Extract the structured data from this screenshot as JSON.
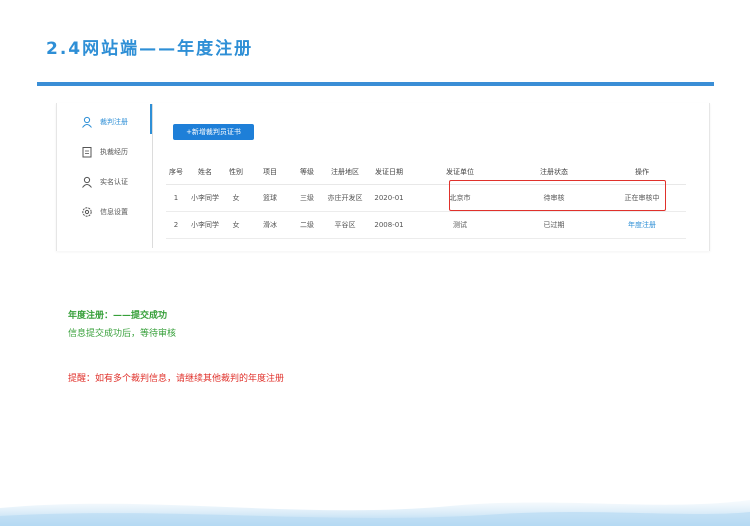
{
  "slide": {
    "title": "2.4网站端——年度注册"
  },
  "sidebar": {
    "items": [
      {
        "label": "裁判注册",
        "icon": "user-icon",
        "active": true
      },
      {
        "label": "执裁经历",
        "icon": "clipboard-icon",
        "active": false
      },
      {
        "label": "实名认证",
        "icon": "user-icon",
        "active": false
      },
      {
        "label": "信息设置",
        "icon": "gear-icon",
        "active": false
      }
    ]
  },
  "toolbar": {
    "add_label": "+新增裁判员证书"
  },
  "table": {
    "headers": [
      "序号",
      "姓名",
      "性别",
      "项目",
      "等级",
      "注册地区",
      "发证日期",
      "发证单位",
      "注册状态",
      "操作"
    ],
    "rows": [
      [
        "1",
        "小李同学",
        "女",
        "篮球",
        "三级",
        "亦庄开发区",
        "2020-01",
        "北京市",
        "待审核",
        "正在审核中"
      ],
      [
        "2",
        "小李同学",
        "女",
        "滑冰",
        "二级",
        "平谷区",
        "2008-01",
        "测试",
        "已过期",
        "年度注册"
      ]
    ]
  },
  "notes": {
    "line1": "年度注册：——提交成功",
    "line2": "信息提交成功后，等待审核",
    "line3": "提醒：如有多个裁判信息，请继续其他裁判的年度注册"
  },
  "colors": {
    "accent": "#2e8fd6",
    "button": "#1e7fd8",
    "success": "#37a03a",
    "warning": "#e0312b"
  }
}
